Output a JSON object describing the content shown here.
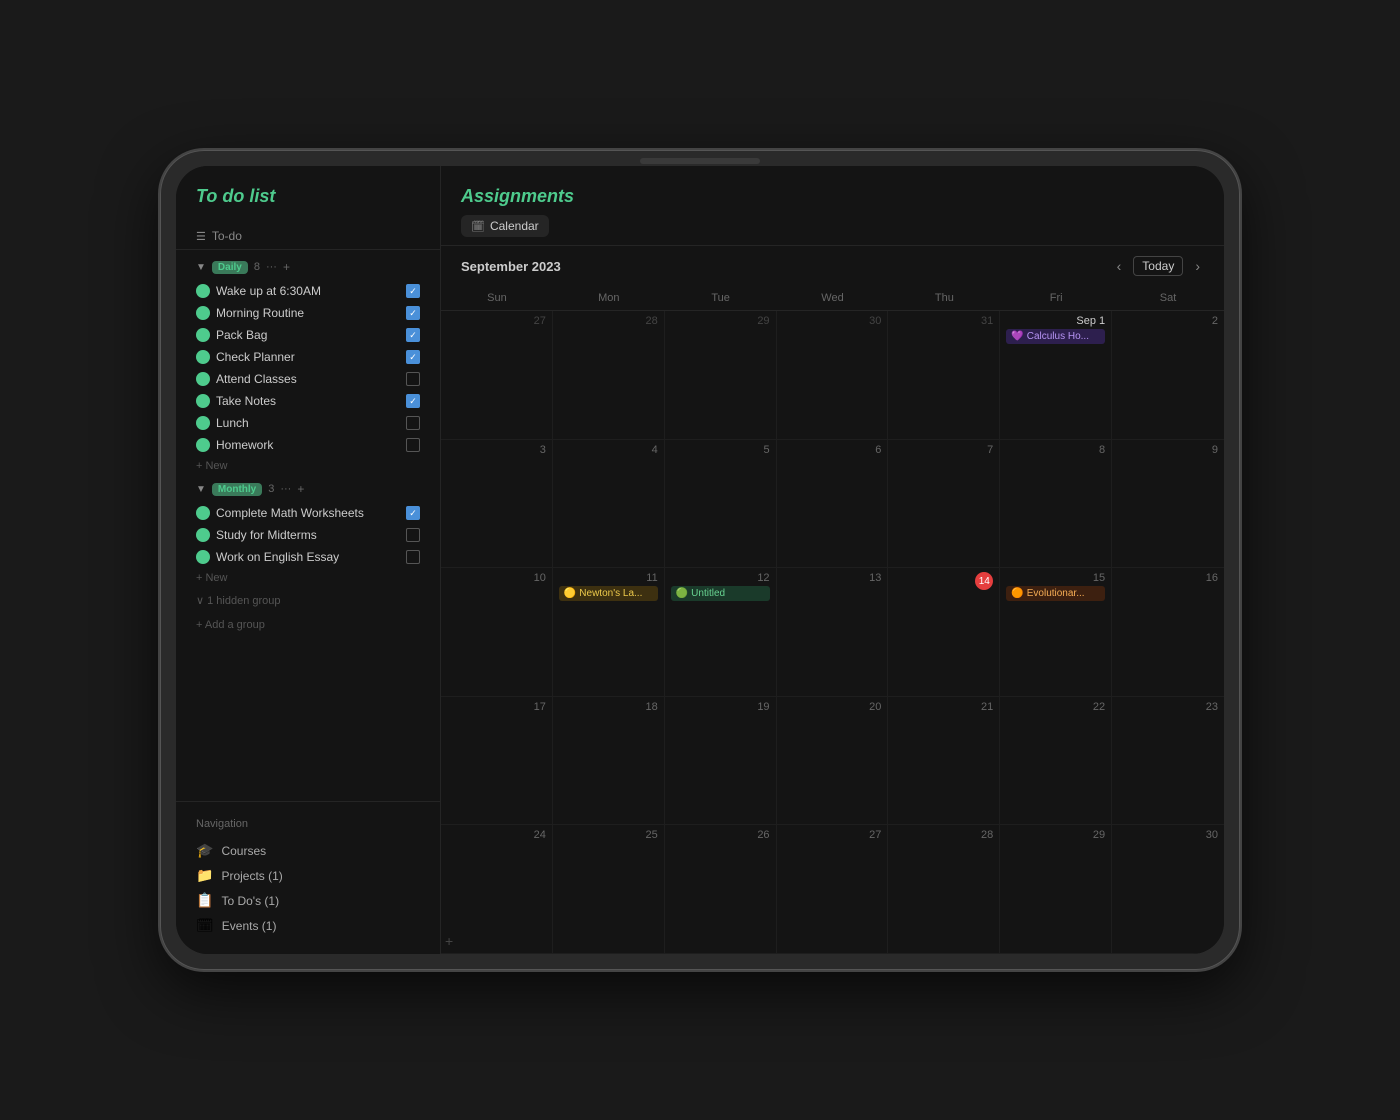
{
  "device": {
    "title": "iPad App"
  },
  "left_panel": {
    "title": "To do list",
    "todo_section_label": "To-do",
    "groups": [
      {
        "name": "Daily",
        "badge": "Daily",
        "count": "8",
        "items": [
          {
            "label": "Wake up at 6:30AM",
            "checked": true,
            "color": "#4ecb8d"
          },
          {
            "label": "Morning Routine",
            "checked": true,
            "color": "#4ecb8d"
          },
          {
            "label": "Pack Bag",
            "checked": true,
            "color": "#4ecb8d"
          },
          {
            "label": "Check Planner",
            "checked": true,
            "color": "#4ecb8d"
          },
          {
            "label": "Attend Classes",
            "checked": false,
            "color": "#4ecb8d"
          },
          {
            "label": "Take Notes",
            "checked": true,
            "color": "#4ecb8d"
          },
          {
            "label": "Lunch",
            "checked": false,
            "color": "#4ecb8d"
          },
          {
            "label": "Homework",
            "checked": false,
            "color": "#4ecb8d"
          }
        ],
        "new_label": "+ New"
      },
      {
        "name": "Monthly",
        "badge": "Monthly",
        "count": "3",
        "items": [
          {
            "label": "Complete Math Worksheets",
            "checked": true,
            "color": "#4ecb8d"
          },
          {
            "label": "Study for Midterms",
            "checked": false,
            "color": "#4ecb8d"
          },
          {
            "label": "Work on English Essay",
            "checked": false,
            "color": "#4ecb8d"
          }
        ],
        "new_label": "+ New"
      }
    ],
    "hidden_group": "∨ 1 hidden group",
    "add_group": "+ Add a group",
    "navigation": {
      "title": "Navigation",
      "items": [
        {
          "icon": "🎓",
          "label": "Courses"
        },
        {
          "icon": "📁",
          "label": "Projects (1)"
        },
        {
          "icon": "📋",
          "label": "To Do's (1)"
        },
        {
          "icon": "🗓",
          "label": "Events (1)"
        }
      ]
    }
  },
  "right_panel": {
    "title": "Assignments",
    "tab_label": "Calendar",
    "nav": {
      "prev": "‹",
      "today": "Today",
      "next": "›",
      "month_year": "September  2023"
    },
    "day_headers": [
      "Sun",
      "Mon",
      "Tue",
      "Wed",
      "Thu",
      "Fri",
      "Sat"
    ],
    "weeks": [
      {
        "cells": [
          {
            "date": "27",
            "month": "other",
            "events": []
          },
          {
            "date": "28",
            "month": "other",
            "events": []
          },
          {
            "date": "29",
            "month": "other",
            "events": []
          },
          {
            "date": "30",
            "month": "other",
            "events": []
          },
          {
            "date": "31",
            "month": "other",
            "events": []
          },
          {
            "date": "Sep 1",
            "month": "current-start",
            "events": [
              {
                "emoji": "💜",
                "label": "Calculus Ho...",
                "type": "purple"
              }
            ]
          },
          {
            "date": "2",
            "month": "current",
            "events": []
          }
        ]
      },
      {
        "cells": [
          {
            "date": "3",
            "month": "current",
            "events": []
          },
          {
            "date": "4",
            "month": "current",
            "events": []
          },
          {
            "date": "5",
            "month": "current",
            "events": []
          },
          {
            "date": "6",
            "month": "current",
            "events": []
          },
          {
            "date": "7",
            "month": "current",
            "events": []
          },
          {
            "date": "8",
            "month": "current",
            "events": []
          },
          {
            "date": "9",
            "month": "current",
            "events": []
          }
        ]
      },
      {
        "cells": [
          {
            "date": "10",
            "month": "current",
            "events": []
          },
          {
            "date": "11",
            "month": "current",
            "events": [
              {
                "emoji": "🟡",
                "label": "Newton's La...",
                "type": "yellow"
              }
            ]
          },
          {
            "date": "12",
            "month": "current",
            "events": [
              {
                "emoji": "🟢",
                "label": "Untitled",
                "type": "green"
              }
            ]
          },
          {
            "date": "13",
            "month": "current",
            "events": []
          },
          {
            "date": "14",
            "month": "current",
            "today": true,
            "events": []
          },
          {
            "date": "15",
            "month": "current",
            "events": [
              {
                "emoji": "🟠",
                "label": "Evolutionar...",
                "type": "orange"
              }
            ]
          },
          {
            "date": "16",
            "month": "current",
            "events": []
          }
        ]
      },
      {
        "cells": [
          {
            "date": "17",
            "month": "current",
            "events": []
          },
          {
            "date": "18",
            "month": "current",
            "events": []
          },
          {
            "date": "19",
            "month": "current",
            "events": []
          },
          {
            "date": "20",
            "month": "current",
            "events": []
          },
          {
            "date": "21",
            "month": "current",
            "events": []
          },
          {
            "date": "22",
            "month": "current",
            "events": []
          },
          {
            "date": "23",
            "month": "current",
            "events": []
          }
        ]
      },
      {
        "cells": [
          {
            "date": "24",
            "month": "current",
            "events": [],
            "add_btn": true
          },
          {
            "date": "25",
            "month": "current",
            "events": []
          },
          {
            "date": "26",
            "month": "current",
            "events": []
          },
          {
            "date": "27",
            "month": "current",
            "events": []
          },
          {
            "date": "28",
            "month": "current",
            "events": []
          },
          {
            "date": "29",
            "month": "current",
            "events": []
          },
          {
            "date": "30",
            "month": "current",
            "events": []
          }
        ]
      }
    ]
  }
}
